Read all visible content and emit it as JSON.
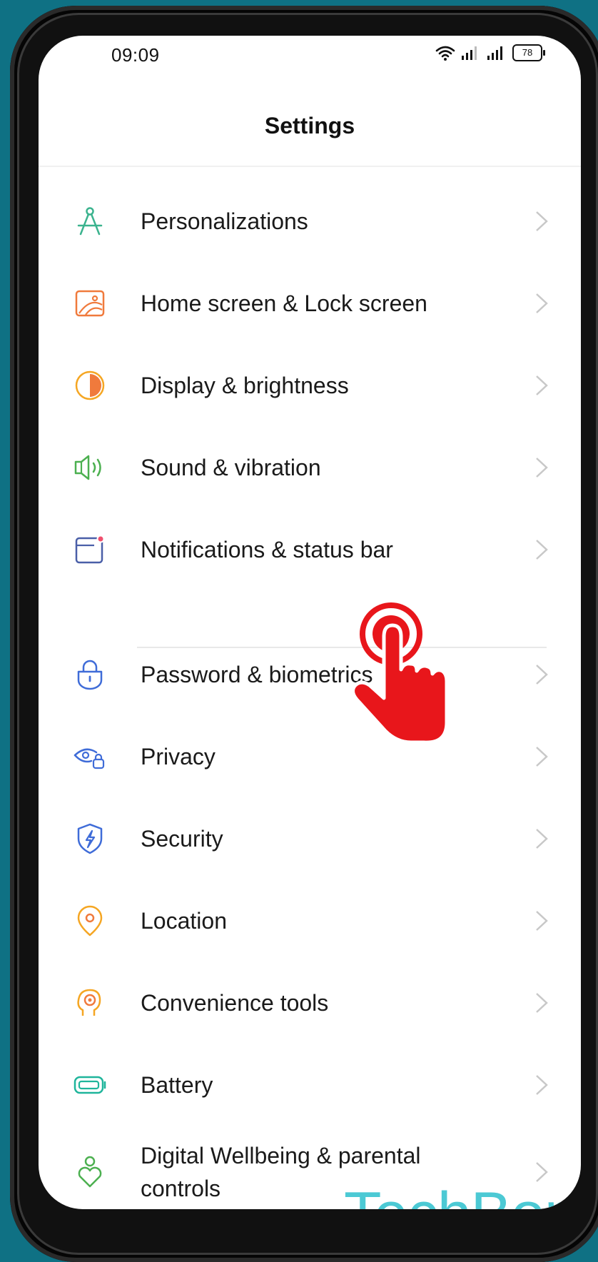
{
  "status_bar": {
    "time": "09:09",
    "battery_level": "78",
    "icons": [
      "wifi-icon",
      "signal-icon",
      "signal-icon",
      "battery-icon"
    ]
  },
  "header": {
    "title": "Settings"
  },
  "settings_items": [
    {
      "label": "Personalizations",
      "icon": "compass-icon",
      "color": "#3bb38e"
    },
    {
      "label": "Home screen & Lock screen",
      "icon": "wallpaper-icon",
      "color": "#f07a3c"
    },
    {
      "label": "Display & brightness",
      "icon": "brightness-icon",
      "color": "#f5a623"
    },
    {
      "label": "Sound & vibration",
      "icon": "speaker-icon",
      "color": "#4cb050"
    },
    {
      "label": "Notifications & status bar",
      "icon": "notification-icon",
      "color": "#4a5fa8"
    },
    {
      "label": "Password & biometrics",
      "icon": "lock-icon",
      "color": "#3f6cd8"
    },
    {
      "label": "Privacy",
      "icon": "eye-lock-icon",
      "color": "#3f6cd8"
    },
    {
      "label": "Security",
      "icon": "shield-icon",
      "color": "#3f6cd8"
    },
    {
      "label": "Location",
      "icon": "location-icon",
      "color": "#f5a623"
    },
    {
      "label": "Convenience tools",
      "icon": "convenience-icon",
      "color": "#f07a3c"
    },
    {
      "label": "Battery",
      "icon": "battery-icon",
      "color": "#1fb59b"
    },
    {
      "label": "Digital Wellbeing & parental controls",
      "icon": "wellbeing-icon",
      "color": "#4cb050"
    }
  ],
  "watermark": "TechBone"
}
